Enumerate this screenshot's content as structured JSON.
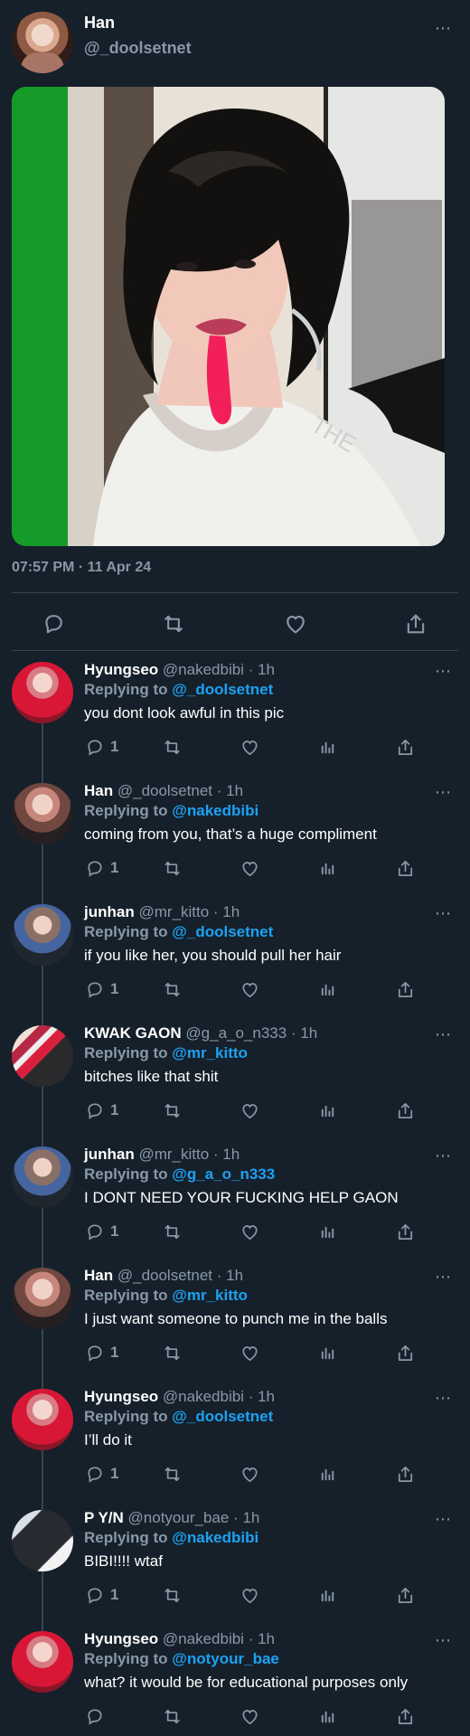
{
  "main": {
    "name": "Han",
    "handle": "@_doolsetnet",
    "timestamp": "07:57 PM · 11 Apr 24",
    "more": "⋯",
    "actions": [
      "reply-icon",
      "retweet-icon",
      "like-icon",
      "share-icon"
    ]
  },
  "replies": [
    {
      "name": "Hyungseo",
      "handle": "@nakedbibi",
      "time": "1h",
      "replying_label": "Replying to",
      "replying_to": "@_doolsetnet",
      "text": "you dont look awful in this pic",
      "reply_count": "1"
    },
    {
      "name": "Han",
      "handle": "@_doolsetnet",
      "time": "1h",
      "replying_label": "Replying to",
      "replying_to": "@nakedbibi",
      "text": "coming from you, that’s a huge compliment",
      "reply_count": "1"
    },
    {
      "name": "junhan",
      "handle": "@mr_kitto",
      "time": "1h",
      "replying_label": "Replying to",
      "replying_to": "@_doolsetnet",
      "text": "if you like her, you should pull her hair",
      "reply_count": "1"
    },
    {
      "name": "KWAK GAON",
      "handle": "@g_a_o_n333",
      "time": "1h",
      "replying_label": "Replying to",
      "replying_to": "@mr_kitto",
      "text": "bitches like that shit",
      "reply_count": "1"
    },
    {
      "name": "junhan",
      "handle": "@mr_kitto",
      "time": "1h",
      "replying_label": "Replying to",
      "replying_to": "@g_a_o_n333",
      "text": "I DONT NEED YOUR FUCKING HELP GAON",
      "reply_count": "1"
    },
    {
      "name": "Han",
      "handle": "@_doolsetnet",
      "time": "1h",
      "replying_label": "Replying to",
      "replying_to": "@mr_kitto",
      "text": "I just want someone to punch me in the balls",
      "reply_count": "1"
    },
    {
      "name": "Hyungseo",
      "handle": "@nakedbibi",
      "time": "1h",
      "replying_label": "Replying to",
      "replying_to": "@_doolsetnet",
      "text": "I’ll do it",
      "reply_count": "1"
    },
    {
      "name": "P Y/N",
      "handle": "@notyour_bae",
      "time": "1h",
      "replying_label": "Replying to",
      "replying_to": "@nakedbibi",
      "text": "BIBI!!!! wtaf",
      "reply_count": "1"
    },
    {
      "name": "Hyungseo",
      "handle": "@nakedbibi",
      "time": "1h",
      "replying_label": "Replying to",
      "replying_to": "@notyour_bae",
      "text": "what? it would be for educational purposes only",
      "reply_count": ""
    }
  ],
  "icons": {
    "reply": "reply-icon",
    "retweet": "retweet-icon",
    "like": "like-icon",
    "analytics": "analytics-icon",
    "share": "share-icon",
    "more": "more-icon"
  }
}
